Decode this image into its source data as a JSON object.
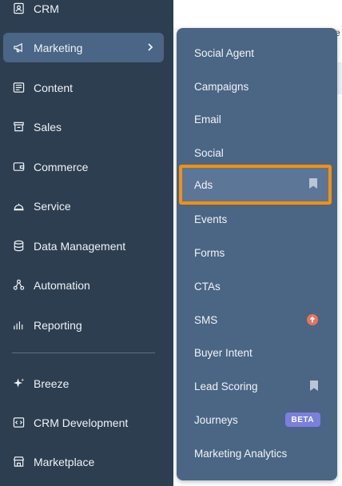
{
  "page": {
    "edge_text": "e"
  },
  "sidebar": {
    "items": [
      {
        "label": "CRM",
        "icon": "contact-card-icon"
      },
      {
        "label": "Marketing",
        "icon": "megaphone-icon"
      },
      {
        "label": "Content",
        "icon": "content-icon"
      },
      {
        "label": "Sales",
        "icon": "sales-icon"
      },
      {
        "label": "Commerce",
        "icon": "wallet-icon"
      },
      {
        "label": "Service",
        "icon": "service-bell-icon"
      },
      {
        "label": "Data Management",
        "icon": "database-icon"
      },
      {
        "label": "Automation",
        "icon": "workflow-icon"
      },
      {
        "label": "Reporting",
        "icon": "bar-chart-icon"
      },
      {
        "label": "Breeze",
        "icon": "sparkle-icon"
      },
      {
        "label": "CRM Development",
        "icon": "code-icon"
      },
      {
        "label": "Marketplace",
        "icon": "storefront-icon"
      }
    ],
    "active": "Marketing"
  },
  "submenu": {
    "items": [
      {
        "label": "Social Agent"
      },
      {
        "label": "Campaigns"
      },
      {
        "label": "Email"
      },
      {
        "label": "Social"
      },
      {
        "label": "Ads",
        "bookmarked": true,
        "highlighted": true
      },
      {
        "label": "Events"
      },
      {
        "label": "Forms"
      },
      {
        "label": "CTAs"
      },
      {
        "label": "SMS",
        "badge": "upgrade-arrow-icon"
      },
      {
        "label": "Buyer Intent"
      },
      {
        "label": "Lead Scoring",
        "bookmarked": true
      },
      {
        "label": "Journeys",
        "badge_text": "BETA"
      },
      {
        "label": "Marketing Analytics"
      }
    ]
  },
  "colors": {
    "sidebar_bg": "#2d3e50",
    "active_item_bg": "#4a6585",
    "submenu_bg": "#4b6584",
    "highlight_border": "#f5900b",
    "beta_badge": "#7a7fe0",
    "upgrade_badge": "#e8735f"
  }
}
